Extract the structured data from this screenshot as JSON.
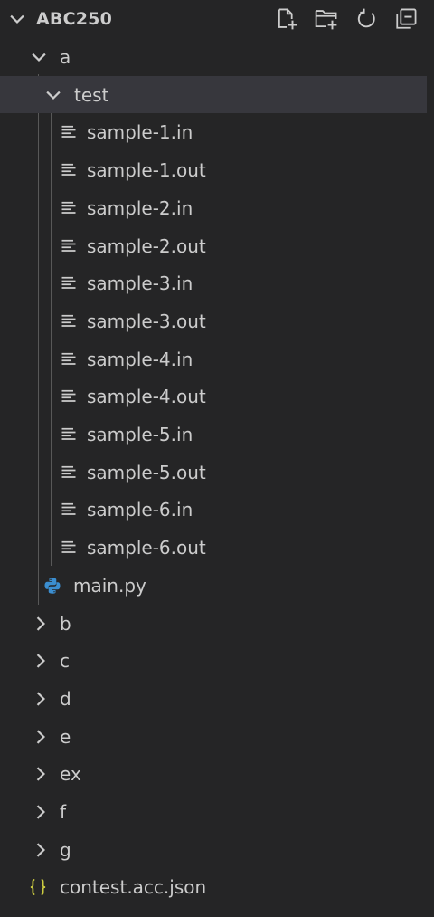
{
  "explorer": {
    "root_title": "ABC250",
    "actions": [
      {
        "name": "new-file-icon"
      },
      {
        "name": "new-folder-icon"
      },
      {
        "name": "refresh-icon"
      },
      {
        "name": "collapse-all-icon"
      }
    ]
  },
  "tree": {
    "folder_a": "a",
    "folder_test": "test",
    "files": [
      "sample-1.in",
      "sample-1.out",
      "sample-2.in",
      "sample-2.out",
      "sample-3.in",
      "sample-3.out",
      "sample-4.in",
      "sample-4.out",
      "sample-5.in",
      "sample-5.out",
      "sample-6.in",
      "sample-6.out"
    ],
    "main_file": "main.py",
    "collapsed_folders": [
      "b",
      "c",
      "d",
      "e",
      "ex",
      "f",
      "g"
    ],
    "json_file": "contest.acc.json",
    "colors": {
      "background": "#252526",
      "selected_row": "#37373d",
      "text": "#cccccc",
      "python_blue": "#3b8ed0",
      "json_yellow": "#cbcb41"
    }
  }
}
